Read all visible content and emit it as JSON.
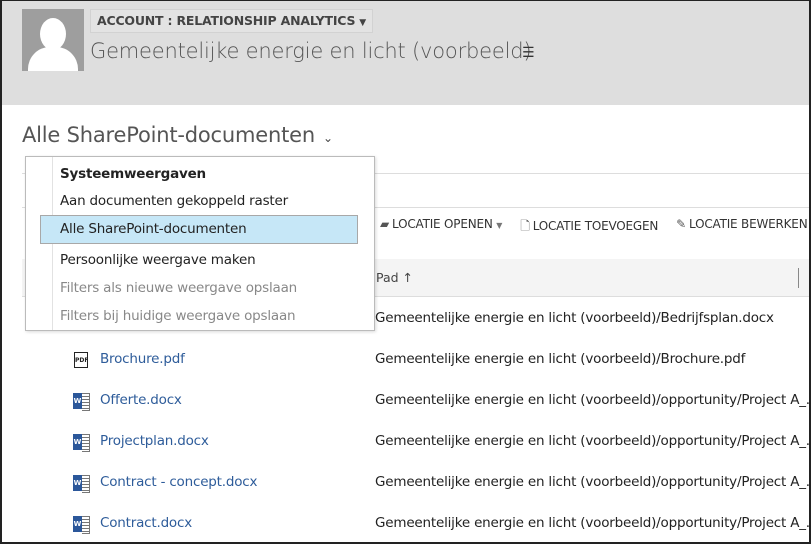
{
  "header": {
    "entity_label": "ACCOUNT : RELATIONSHIP ANALYTICS",
    "record_title": "Gemeentelijke energie en licht (voorbeeld)"
  },
  "view": {
    "title": "Alle SharePoint-documenten"
  },
  "toolbar": {
    "open_location": "LOCATIE OPENEN",
    "add_location": "LOCATIE TOEVOEGEN",
    "edit_location": "LOCATIE BEWERKEN"
  },
  "table": {
    "path_header": "Pad ↑",
    "rows": [
      {
        "name": "",
        "path": "Gemeentelijke energie en licht (voorbeeld)/Bedrijfsplan.docx",
        "icon": "word"
      },
      {
        "name": "Brochure.pdf",
        "path": "Gemeentelijke energie en licht (voorbeeld)/Brochure.pdf",
        "icon": "pdf"
      },
      {
        "name": "Offerte.docx",
        "path": "Gemeentelijke energie en licht (voorbeeld)/opportunity/Project A_...",
        "icon": "word"
      },
      {
        "name": "Projectplan.docx",
        "path": "Gemeentelijke energie en licht (voorbeeld)/opportunity/Project A_...",
        "icon": "word"
      },
      {
        "name": "Contract - concept.docx",
        "path": "Gemeentelijke energie en licht (voorbeeld)/opportunity/Project A_...",
        "icon": "word"
      },
      {
        "name": "Contract.docx",
        "path": "Gemeentelijke energie en licht (voorbeeld)/opportunity/Project A_...",
        "icon": "word"
      }
    ]
  },
  "menu": {
    "section": "Systeemweergaven",
    "items": [
      "Aan documenten gekoppeld raster",
      "Alle SharePoint-documenten",
      "Persoonlijke weergave maken",
      "Filters als nieuwe weergave opslaan",
      "Filters bij huidige weergave opslaan"
    ],
    "selected": "Alle SharePoint-documenten"
  },
  "colors": {
    "header_bg": "#dedede",
    "link": "#2e5c9a",
    "selected_bg": "#c6e7f7"
  }
}
